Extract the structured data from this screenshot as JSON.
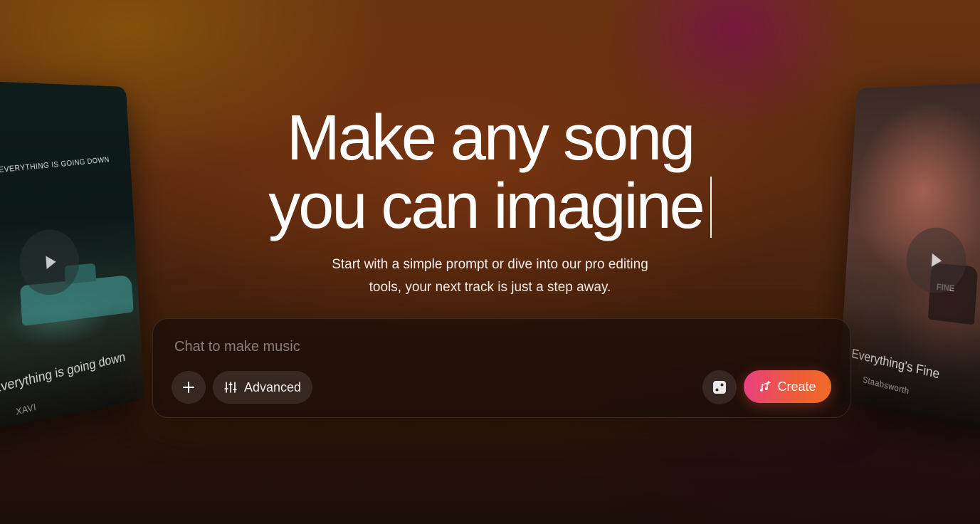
{
  "hero": {
    "headline_line1": "Make any song",
    "headline_line2": "you can imagine",
    "subtitle_line1": "Start with a simple prompt or dive into our pro editing",
    "subtitle_line2": "tools, your next track is just a step away."
  },
  "prompt": {
    "placeholder": "Chat to make music",
    "add_icon": "plus-icon",
    "advanced_label": "Advanced",
    "advanced_icon": "sliders-icon",
    "random_icon": "dice-icon",
    "create_label": "Create",
    "create_icon": "music-note-plus-icon",
    "create_gradient": [
      "#e8407e",
      "#f06a28"
    ]
  },
  "cards": {
    "left": {
      "banner": "EVERYTHING IS GOING DOWN",
      "title": "Everything is going down",
      "artist": "XAVI",
      "play_icon": "play-icon"
    },
    "right": {
      "title": "Everything's Fine",
      "artist": "Staabsworth",
      "shirt_text": "FINE",
      "play_icon": "play-icon"
    }
  }
}
